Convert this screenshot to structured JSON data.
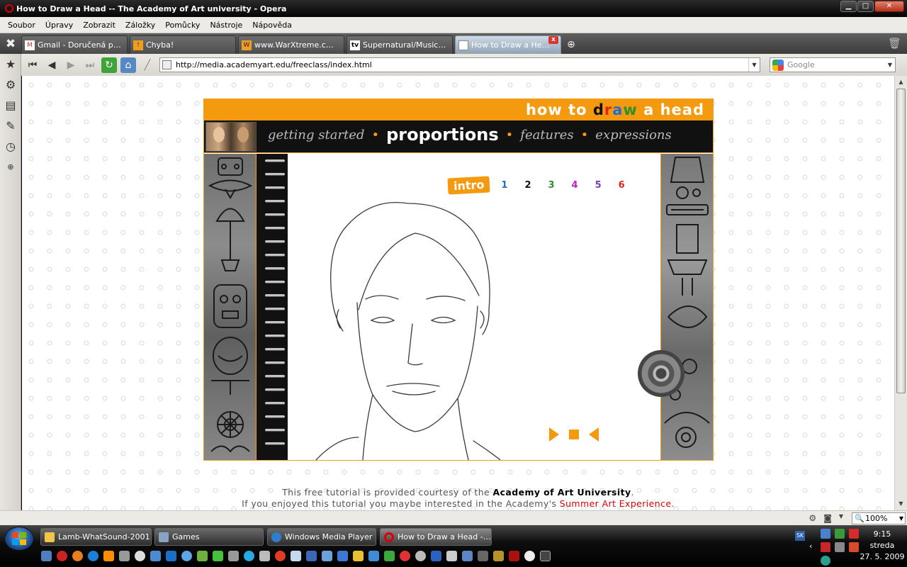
{
  "window": {
    "title": "How to Draw a Head -- The Academy of Art university - Opera",
    "min": "▁",
    "max": "□",
    "close": "✕"
  },
  "menu": [
    "Soubor",
    "Úpravy",
    "Zobrazit",
    "Záložky",
    "Pomůcky",
    "Nástroje",
    "Nápověda"
  ],
  "tabs": [
    {
      "title": "Gmail - Doručená p…",
      "icon": "gmail-icon",
      "color": "#d9322b"
    },
    {
      "title": "Chyba!",
      "icon": "warning-icon",
      "color": "#f29c1b"
    },
    {
      "title": "www.WarXtreme.c…",
      "icon": "warxtreme-icon",
      "color": "#e8a12a"
    },
    {
      "title": "Supernatural/Music…",
      "icon": "tv-icon",
      "color": "#333333"
    },
    {
      "title": "How to Draw a He…",
      "icon": "page-icon",
      "color": "#ffffff",
      "active": true
    }
  ],
  "address": {
    "url": "http://media.academyart.edu/freeclass/index.html",
    "search_placeholder": "Google"
  },
  "page": {
    "header_prefix": "how to ",
    "header_word": [
      "d",
      "r",
      "a",
      "w"
    ],
    "header_word_colors": [
      "#111111",
      "#e0261c",
      "#1f6fd1",
      "#2f8f2a"
    ],
    "header_suffix": " a head",
    "nav": [
      "getting started",
      "proportions",
      "features",
      "expressions"
    ],
    "pager": {
      "intro": "intro",
      "pages": [
        "1",
        "2",
        "3",
        "4",
        "5",
        "6"
      ],
      "colors": [
        "#1f6fd1",
        "#111111",
        "#2f8f2a",
        "#c21ec9",
        "#7a3fbf",
        "#e0261c"
      ]
    },
    "footer": {
      "line1_pre": "This free tutorial is provided courtesy of the ",
      "line1_bold": "Academy of Art University",
      "line1_post": ".",
      "line2_pre": "If you enjoyed this tutorial you maybe interested in the Academy's ",
      "line2_link": "Summer Art Experience",
      "line2_post": "."
    }
  },
  "status": {
    "zoom": "100%"
  },
  "taskbar": {
    "buttons": [
      "Lamb-WhatSound-2001",
      "Games",
      "Windows Media Player",
      "How to Draw a Head -…"
    ],
    "lang": "SK",
    "time": "9:15",
    "day": "streda",
    "date": "27. 5. 2009"
  },
  "colors": {
    "accent": "#f5990f",
    "link_red": "#dd0000"
  }
}
